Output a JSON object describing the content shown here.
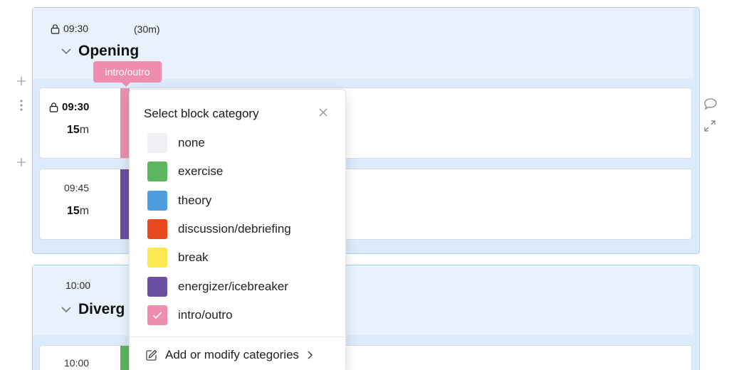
{
  "sections": [
    {
      "time": "09:30",
      "locked": true,
      "duration": "(30m)",
      "title": "Opening"
    },
    {
      "time": "10:00",
      "locked": false,
      "title": "Diverg"
    }
  ],
  "blocks": [
    {
      "time": "09:30",
      "locked": true,
      "duration_value": "15",
      "duration_unit": "m",
      "color": "#e891b0"
    },
    {
      "time": "09:45",
      "locked": false,
      "duration_value": "15",
      "duration_unit": "m",
      "color": "#6f4ea0"
    },
    {
      "time": "10:00",
      "locked": false,
      "color": "#5cb55f"
    }
  ],
  "category_tag": {
    "label": "intro/outro",
    "color": "#f08cad"
  },
  "popup": {
    "title": "Select block category",
    "options": [
      {
        "label": "none",
        "color": "#eef0f3",
        "selected": false
      },
      {
        "label": "exercise",
        "color": "#5cb55f",
        "selected": false
      },
      {
        "label": "theory",
        "color": "#4f9dde",
        "selected": false
      },
      {
        "label": "discussion/debriefing",
        "color": "#e8491e",
        "selected": false
      },
      {
        "label": "break",
        "color": "#fbe94f",
        "selected": false
      },
      {
        "label": "energizer/icebreaker",
        "color": "#6a51a3",
        "selected": false
      },
      {
        "label": "intro/outro",
        "color": "#ef8db0",
        "selected": true
      }
    ],
    "footer_label": "Add or modify categories"
  },
  "icons": {
    "add": "plus-icon",
    "drag": "drag-handle-icon",
    "lock": "lock-icon",
    "chevron": "chevron-down-icon",
    "close": "close-icon",
    "check": "check-icon",
    "edit": "edit-icon",
    "comment": "comment-icon",
    "expand": "expand-icon"
  }
}
